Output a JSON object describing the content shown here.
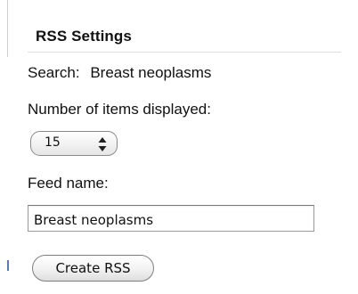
{
  "rss_settings": {
    "title": "RSS Settings",
    "search_label": "Search:",
    "search_value": "Breast neoplasms",
    "items_label": "Number of items displayed:",
    "items_count": "15",
    "feed_name_label": "Feed name:",
    "feed_name_value": "Breast neoplasms",
    "create_button_label": "Create RSS"
  },
  "icons": {
    "stepper": "up-down-stepper-arrows-icon"
  },
  "colors": {
    "text": "#111111",
    "border": "#8a8a8a",
    "divider": "#dddddd"
  }
}
